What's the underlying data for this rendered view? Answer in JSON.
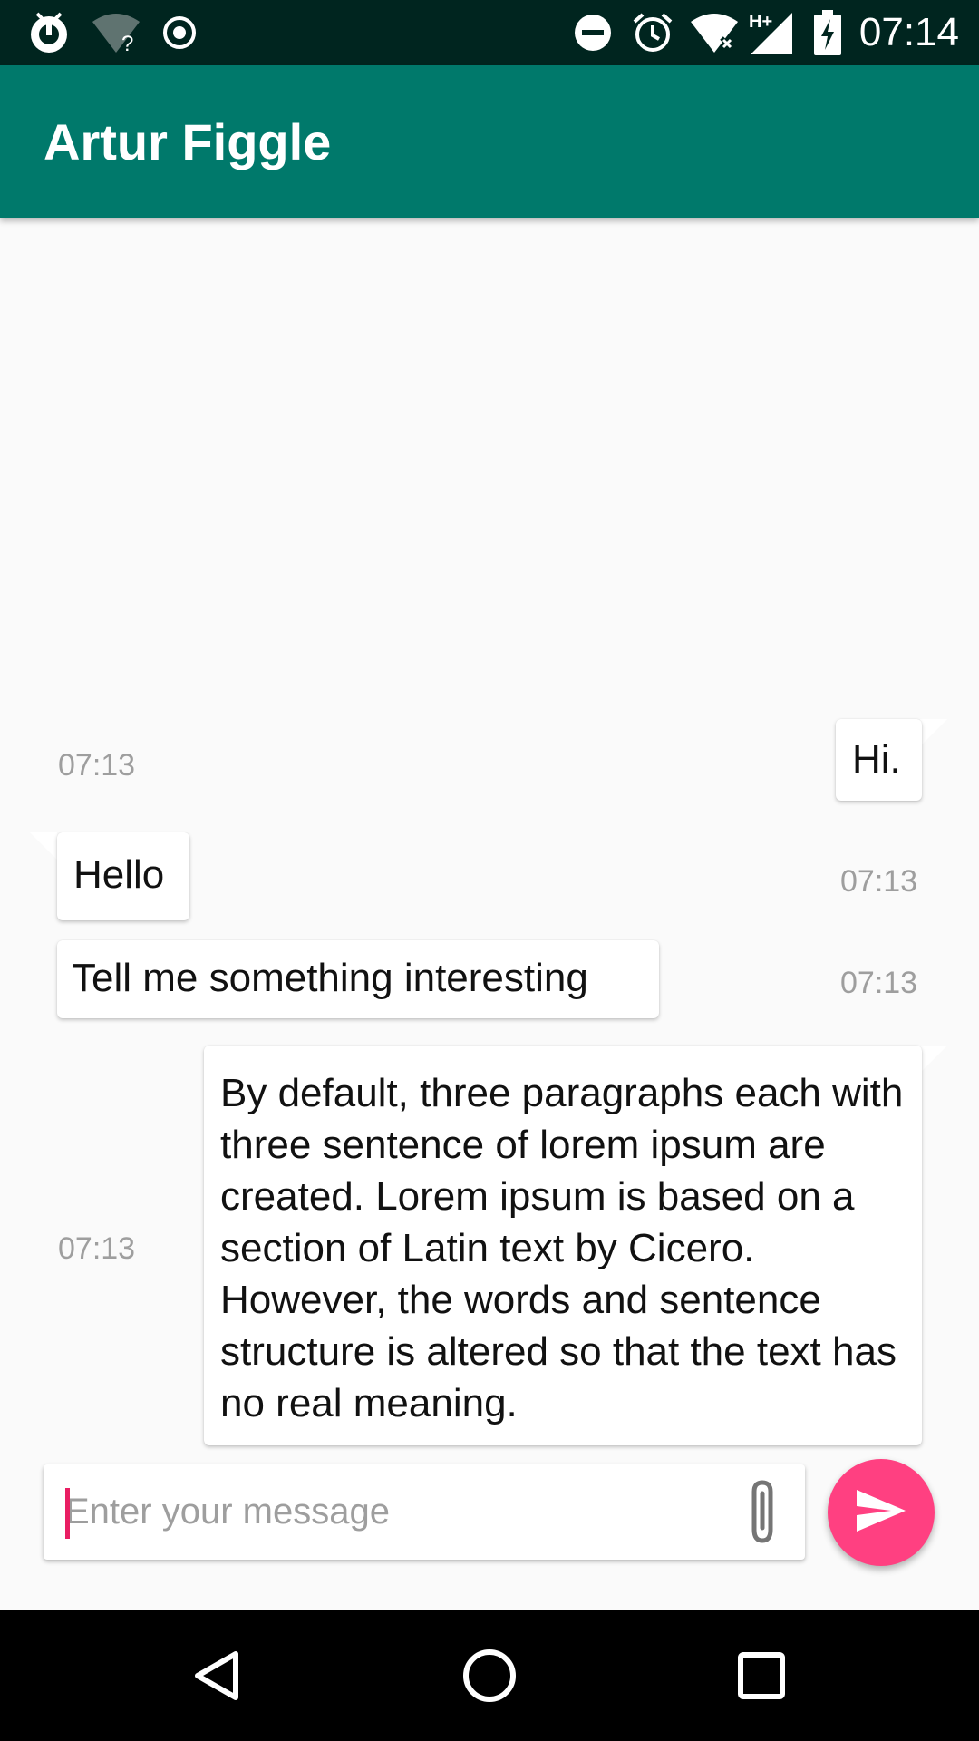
{
  "status_bar": {
    "time": "07:14",
    "left_icons": [
      "app-notification-icon",
      "wifi-unknown-icon",
      "record-icon"
    ],
    "right_icons": [
      "do-not-disturb-icon",
      "alarm-icon",
      "wifi-no-internet-icon",
      "signal-hplus-icon",
      "battery-charging-icon"
    ]
  },
  "app_bar": {
    "title": "Artur Figgle",
    "color": "#00796b"
  },
  "messages": [
    {
      "side": "outgoing",
      "text": "Hi.",
      "time": "07:13"
    },
    {
      "side": "incoming",
      "text": "Hello",
      "time": "07:13"
    },
    {
      "side": "incoming",
      "text": "Tell me something interesting",
      "time": "07:13"
    },
    {
      "side": "outgoing",
      "text": "By default, three paragraphs each with three sentence of lorem ipsum are created. Lorem ipsum is based on a section of Latin text by Cicero. However, the words and sentence structure is altered so that the text has no real meaning.",
      "time": "07:13"
    }
  ],
  "composer": {
    "placeholder": "Enter your message",
    "value": "",
    "attach_icon": "paperclip-icon",
    "send_icon": "send-icon",
    "accent": "#ff4081"
  },
  "nav_bar": {
    "buttons": [
      "back-icon",
      "home-icon",
      "recents-icon"
    ]
  }
}
